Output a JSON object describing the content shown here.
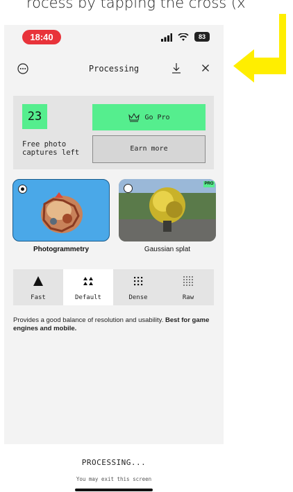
{
  "caption": {
    "text": "rocess by tapping the cross (x"
  },
  "status_bar": {
    "time": "18:40",
    "battery": "83",
    "icons": [
      "signal-icon",
      "wifi-icon",
      "battery-icon"
    ]
  },
  "header": {
    "title": "Processing",
    "icons": [
      "more-options-icon",
      "download-icon",
      "close-icon"
    ]
  },
  "pro_card": {
    "captures_count": "23",
    "captures_label": "Free photo captures left",
    "go_pro_label": "Go Pro",
    "earn_more_label": "Earn more"
  },
  "methods": [
    {
      "label": "Photogrammetry",
      "selected": true
    },
    {
      "label": "Gaussian splat",
      "selected": false,
      "badge": "PRO"
    }
  ],
  "density": {
    "options": [
      {
        "label": "Fast",
        "icon": "triangle-icon"
      },
      {
        "label": "Default",
        "icon": "four-triangles-icon",
        "selected": true
      },
      {
        "label": "Dense",
        "icon": "dot-grid-icon"
      },
      {
        "label": "Raw",
        "icon": "fine-dot-grid-icon"
      }
    ]
  },
  "description": {
    "plain": "Provides a good balance of resolution and usability. ",
    "bold": "Best for game engines and mobile."
  },
  "bottom": {
    "status": "PROCESSING...",
    "hint": "You may exit this screen"
  },
  "colors": {
    "accent_green": "#55ee8e",
    "time_pill_red": "#e8333a",
    "annotation_arrow_yellow": "#ffee00",
    "selected_method_blue": "#4aa8e8"
  }
}
